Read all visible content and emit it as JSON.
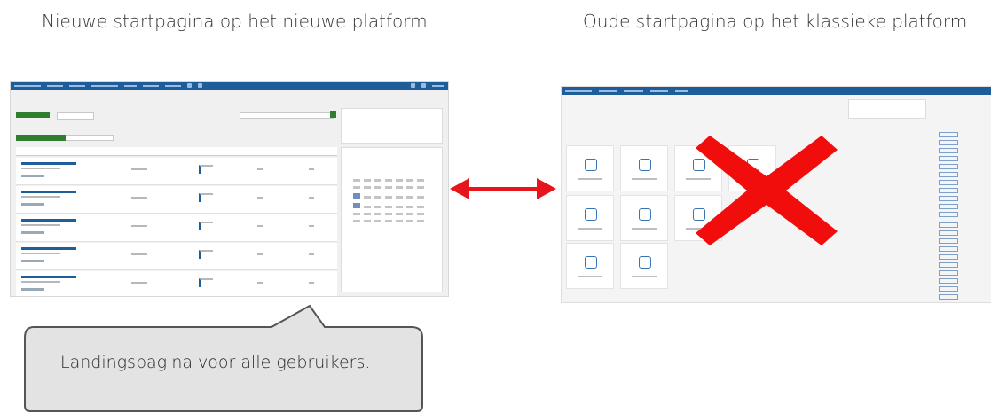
{
  "captions": {
    "left": "Nieuwe startpagina op het nieuwe platform",
    "right": "Oude startpagina op het klassieke platform"
  },
  "callout": {
    "text": "Landingspagina voor alle gebruikers."
  },
  "colors": {
    "arrow": "#e8141b",
    "cross": "#f20d0d",
    "navbar": "#1d5d9a",
    "accent_green": "#2f7d2f"
  },
  "icons": {
    "arrow": "double-headed-arrow-icon",
    "cross": "red-cross-icon"
  }
}
